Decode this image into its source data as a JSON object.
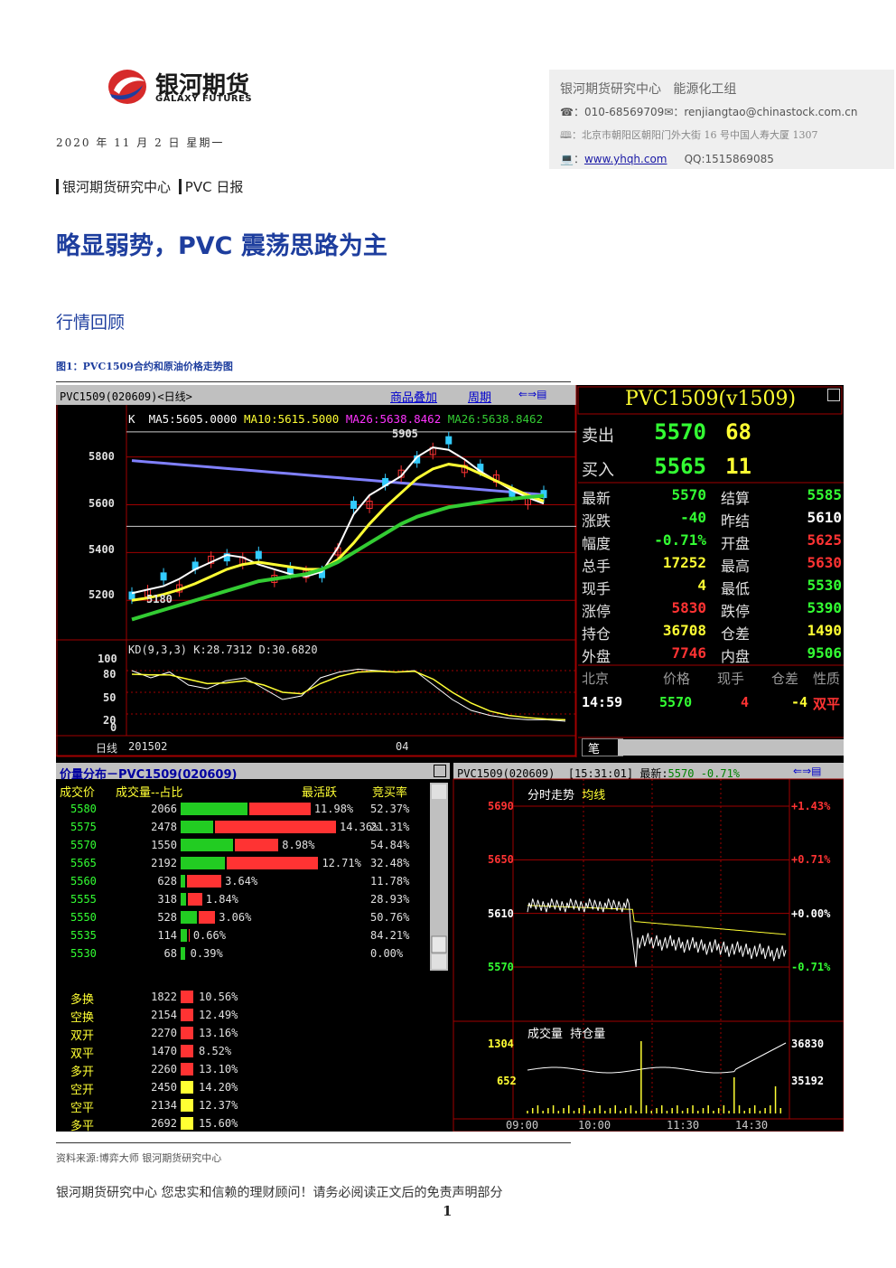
{
  "header": {
    "logo_cn": "银河期货",
    "logo_en": "GALAXY FUTURES",
    "date": "2020 年 11 月 2 日  星期一",
    "breadcrumb_org": "银河期货研究中心",
    "breadcrumb_report": "PVC 日报"
  },
  "contact": {
    "org": "银河期货研究中心",
    "group": "能源化工组",
    "phone_label": "☎：",
    "phone": "010-68569709",
    "email_label": "✉：",
    "email": "renjiangtao@chinastock.com.cn",
    "address_label": "🕮：",
    "address": "北京市朝阳区朝阳门外大街 16 号中国人寿大厦 1307",
    "web_label": "💻：",
    "website": "www.yhqh.com",
    "qq": "QQ:1515869085"
  },
  "article": {
    "title": "略显弱势，PVC 震荡思路为主",
    "section": "行情回顾",
    "figure_caption": "图1：PVC1509合约和原油价格走势图",
    "source": "资料来源:博弈大师   银河期货研究中心",
    "footer": "银河期货研究中心  您忠实和信赖的理财顾问！请务必阅读正文后的免责声明部分",
    "page_number": "1"
  },
  "kline": {
    "title": "PVC1509(020609)<日线>",
    "btn_overlay": "商品叠加",
    "btn_period": "周期",
    "ma_legend_k": "K",
    "ma5": "MA5:5605.0000",
    "ma10": "MA10:5615.5000",
    "ma26a": "MA26:5638.8462",
    "ma26b": "MA26:5638.8462",
    "high_label": "5905",
    "low_label": "5180",
    "y_ticks": [
      "5800",
      "5600",
      "5400",
      "5200"
    ],
    "kd_title": "KD(9,3,3)",
    "kd_k": "K:28.7312",
    "kd_d": "D:30.6820",
    "kd_ticks": [
      "100",
      "80",
      "50",
      "20",
      "0"
    ],
    "x_label": "日线",
    "x_start": "201502",
    "x_mid": "04",
    "colors": {
      "up": "#ff3333",
      "down": "#33ccff",
      "ma5": "#ffffff",
      "ma10": "#ffff33",
      "ma26a": "#ff33ff",
      "ma26b": "#33cc33",
      "long": "#8080ff"
    }
  },
  "chart_data": [
    {
      "type": "line",
      "title": "PVC1509(020609)<日线>",
      "series": [
        {
          "name": "MA5",
          "values": [
            5230,
            5245,
            5260,
            5290,
            5330,
            5360,
            5390,
            5380,
            5350,
            5330,
            5310,
            5300,
            5320,
            5420,
            5560,
            5640,
            5680,
            5720,
            5800,
            5840,
            5830,
            5790,
            5740,
            5700,
            5660,
            5630,
            5605
          ]
        },
        {
          "name": "MA10",
          "values": [
            5200,
            5210,
            5225,
            5245,
            5270,
            5300,
            5330,
            5350,
            5360,
            5350,
            5340,
            5330,
            5330,
            5370,
            5440,
            5520,
            5590,
            5650,
            5710,
            5750,
            5770,
            5760,
            5730,
            5700,
            5670,
            5640,
            5615
          ]
        },
        {
          "name": "MA26",
          "values": [
            5120,
            5140,
            5160,
            5180,
            5200,
            5220,
            5240,
            5260,
            5280,
            5290,
            5300,
            5310,
            5330,
            5360,
            5400,
            5440,
            5480,
            5520,
            5550,
            5570,
            5590,
            5600,
            5610,
            5620,
            5625,
            5632,
            5638
          ]
        }
      ],
      "ylim": [
        5080,
        5950
      ],
      "yticks": [
        5200,
        5400,
        5600,
        5800
      ]
    },
    {
      "type": "bar",
      "title": "价量分布－PVC1509(020609)",
      "categories": [
        "5580",
        "5575",
        "5570",
        "5565",
        "5560",
        "5555",
        "5550",
        "5535",
        "5530"
      ],
      "series": [
        {
          "name": "成交量",
          "values": [
            2066,
            2478,
            1550,
            2192,
            628,
            318,
            528,
            114,
            68
          ]
        },
        {
          "name": "占比",
          "values": [
            11.98,
            14.36,
            8.98,
            12.71,
            3.64,
            1.84,
            3.06,
            0.66,
            0.39
          ]
        }
      ]
    }
  ],
  "quote": {
    "title": "PVC1509(v1509)",
    "sell_label": "卖出",
    "sell_price": "5570",
    "sell_vol": "68",
    "buy_label": "买入",
    "buy_price": "5565",
    "buy_vol": "11",
    "rows": [
      {
        "l1": "最新",
        "v1": "5570",
        "c1": "#33ff33",
        "l2": "结算",
        "v2": "5585",
        "c2": "#33ff33"
      },
      {
        "l1": "涨跌",
        "v1": "-40",
        "c1": "#33ff33",
        "l2": "昨结",
        "v2": "5610",
        "c2": "#ffffff"
      },
      {
        "l1": "幅度",
        "v1": "-0.71%",
        "c1": "#33ff33",
        "l2": "开盘",
        "v2": "5625",
        "c2": "#ff3333"
      },
      {
        "l1": "总手",
        "v1": "17252",
        "c1": "#ffff33",
        "l2": "最高",
        "v2": "5630",
        "c2": "#ff3333"
      },
      {
        "l1": "现手",
        "v1": "4",
        "c1": "#ffff33",
        "l2": "最低",
        "v2": "5530",
        "c2": "#33ff33"
      },
      {
        "l1": "涨停",
        "v1": "5830",
        "c1": "#ff3333",
        "l2": "跌停",
        "v2": "5390",
        "c2": "#33ff33"
      },
      {
        "l1": "持仓",
        "v1": "36708",
        "c1": "#ffff33",
        "l2": "仓差",
        "v2": "1490",
        "c2": "#ffff33"
      },
      {
        "l1": "外盘",
        "v1": "7746",
        "c1": "#ff3333",
        "l2": "内盘",
        "v2": "9506",
        "c2": "#33ff33"
      }
    ],
    "tick_headers": [
      "北京",
      "价格",
      "现手",
      "仓差",
      "性质"
    ],
    "tick": {
      "time": "14:59",
      "price": "5570",
      "vol": "4",
      "oi": "-4",
      "nature": "双平"
    },
    "tab": "笔"
  },
  "dist": {
    "title": "价量分布－PVC1509(020609)",
    "h_price": "成交价",
    "h_vol": "成交量--占比",
    "h_active": "最活跃",
    "h_ratio": "竞买率",
    "rows": [
      {
        "price": "5580",
        "vol": "2066",
        "pct": "11.98%",
        "ratio": "52.37%",
        "g": 0.524,
        "r": 0.476
      },
      {
        "price": "5575",
        "vol": "2478",
        "pct": "14.36%",
        "ratio": "21.31%",
        "g": 0.213,
        "r": 0.787
      },
      {
        "price": "5570",
        "vol": "1550",
        "pct": "8.98%",
        "ratio": "54.84%",
        "g": 0.548,
        "r": 0.452
      },
      {
        "price": "5565",
        "vol": "2192",
        "pct": "12.71%",
        "ratio": "32.48%",
        "g": 0.325,
        "r": 0.675
      },
      {
        "price": "5560",
        "vol": "628",
        "pct": "3.64%",
        "ratio": "11.78%",
        "g": 0.118,
        "r": 0.882
      },
      {
        "price": "5555",
        "vol": "318",
        "pct": "1.84%",
        "ratio": "28.93%",
        "g": 0.289,
        "r": 0.711
      },
      {
        "price": "5550",
        "vol": "528",
        "pct": "3.06%",
        "ratio": "50.76%",
        "g": 0.508,
        "r": 0.492
      },
      {
        "price": "5535",
        "vol": "114",
        "pct": "0.66%",
        "ratio": "84.21%",
        "g": 0.842,
        "r": 0.158
      },
      {
        "price": "5530",
        "vol": "68",
        "pct": "0.39%",
        "ratio": "0.00%",
        "g": 1.0,
        "r": 0.0
      }
    ],
    "types": [
      {
        "name": "多换",
        "vol": "1822",
        "pct": "10.56%",
        "color": "#ff3333"
      },
      {
        "name": "空换",
        "vol": "2154",
        "pct": "12.49%",
        "color": "#ff3333"
      },
      {
        "name": "双开",
        "vol": "2270",
        "pct": "13.16%",
        "color": "#ff3333"
      },
      {
        "name": "双平",
        "vol": "1470",
        "pct": "8.52%",
        "color": "#ff3333"
      },
      {
        "name": "多开",
        "vol": "2260",
        "pct": "13.10%",
        "color": "#ff3333"
      },
      {
        "name": "空开",
        "vol": "2450",
        "pct": "14.20%",
        "color": "#ffff33"
      },
      {
        "name": "空平",
        "vol": "2134",
        "pct": "12.37%",
        "color": "#ffff33"
      },
      {
        "name": "多平",
        "vol": "2692",
        "pct": "15.60%",
        "color": "#ffff33"
      }
    ]
  },
  "intraday": {
    "title": "PVC1509(020609)",
    "time": "[15:31:01]",
    "latest_label": "最新:",
    "latest": "5570",
    "change": "-0.71%",
    "line_label": "分时走势",
    "avg_label": "均线",
    "prices": [
      "5690",
      "5650",
      "5610",
      "5570"
    ],
    "pcts": [
      "+1.43%",
      "+0.71%",
      "+0.00%",
      "-0.71%"
    ],
    "vol_label": "成交量",
    "oi_label": "持仓量",
    "vol_ticks": [
      "1304",
      "652"
    ],
    "oi_ticks": [
      "36830",
      "35192"
    ],
    "times": [
      "09:00",
      "10:00",
      "11:30",
      "14:30"
    ]
  }
}
